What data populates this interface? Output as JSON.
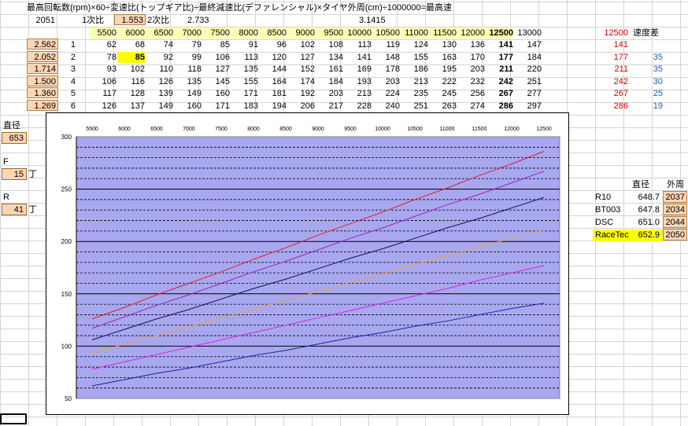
{
  "title": "最高回転数(rpm)×60÷変速比(トップギア比)÷最終減速比(デファレンシャル)×タイヤ外周(cm)÷1000000=最高速",
  "params": {
    "cell_2051": "2051",
    "first_ratio_label": "1次比",
    "first_ratio_value": "1.553",
    "second_ratio_label": "2次比",
    "second_ratio_value": "2.733",
    "pi_value": "3.1415"
  },
  "rpm_headers": [
    "5500",
    "6000",
    "6500",
    "7000",
    "7500",
    "8000",
    "8500",
    "9000",
    "9500",
    "10000",
    "10500",
    "11000",
    "11500",
    "12000",
    "12500",
    "13000"
  ],
  "extra_headers": {
    "rpm_red": "12500",
    "speed_diff": "速度差"
  },
  "gears": [
    {
      "ratio": "2.562",
      "num": "1",
      "speeds": [
        "62",
        "68",
        "74",
        "79",
        "85",
        "91",
        "96",
        "102",
        "108",
        "113",
        "119",
        "124",
        "130",
        "136",
        "141",
        "147"
      ],
      "red": "141",
      "diff": ""
    },
    {
      "ratio": "2.052",
      "num": "2",
      "speeds": [
        "78",
        "85",
        "92",
        "99",
        "106",
        "113",
        "120",
        "127",
        "134",
        "141",
        "148",
        "155",
        "163",
        "170",
        "177",
        "184"
      ],
      "red": "177",
      "diff": "35"
    },
    {
      "ratio": "1.714",
      "num": "3",
      "speeds": [
        "93",
        "102",
        "110",
        "118",
        "127",
        "135",
        "144",
        "152",
        "161",
        "169",
        "178",
        "186",
        "195",
        "203",
        "211",
        "220"
      ],
      "red": "211",
      "diff": "35"
    },
    {
      "ratio": "1.500",
      "num": "4",
      "speeds": [
        "106",
        "116",
        "126",
        "135",
        "145",
        "155",
        "164",
        "174",
        "184",
        "193",
        "203",
        "213",
        "222",
        "232",
        "242",
        "251"
      ],
      "red": "242",
      "diff": "30"
    },
    {
      "ratio": "1.360",
      "num": "5",
      "speeds": [
        "117",
        "128",
        "139",
        "149",
        "160",
        "171",
        "181",
        "192",
        "203",
        "213",
        "224",
        "235",
        "245",
        "256",
        "267",
        "277"
      ],
      "red": "267",
      "diff": "25"
    },
    {
      "ratio": "1.269",
      "num": "6",
      "speeds": [
        "126",
        "137",
        "149",
        "160",
        "171",
        "183",
        "194",
        "206",
        "217",
        "228",
        "240",
        "251",
        "263",
        "274",
        "286",
        "297"
      ],
      "red": "286",
      "diff": "19"
    }
  ],
  "side": {
    "diameter_label": "直径",
    "diameter_value": "653",
    "f_label": "F",
    "f_value": "15",
    "f_unit": "丁",
    "r_label": "R",
    "r_value": "41",
    "r_unit": "丁"
  },
  "tyre_table": {
    "header_diameter": "直径",
    "header_circumference": "外周",
    "rows": [
      {
        "name": "R10",
        "diameter": "648.7",
        "circumference": "2037",
        "highlight": false
      },
      {
        "name": "BT003",
        "diameter": "647.8",
        "circumference": "2034",
        "highlight": false
      },
      {
        "name": "DSC",
        "diameter": "651.0",
        "circumference": "2044",
        "highlight": false
      },
      {
        "name": "RaceTec",
        "diameter": "652.9",
        "circumference": "2050",
        "highlight": true
      }
    ]
  },
  "colors": {
    "plot_bg": "#a8a8f0",
    "gear_lines": [
      "#2020a0",
      "#e020e0",
      "#f0a040",
      "#101050",
      "#a020c0",
      "#e02020"
    ]
  },
  "chart_data": {
    "type": "line",
    "x": [
      5500,
      6000,
      6500,
      7000,
      7500,
      8000,
      8500,
      9000,
      9500,
      10000,
      10500,
      11000,
      11500,
      12000,
      12500
    ],
    "x_tick_labels": [
      "5500",
      "6000",
      "6500",
      "7000",
      "7500",
      "8000",
      "8500",
      "9000",
      "9500",
      "10000",
      "10500",
      "11000",
      "11500",
      "12000",
      "12500"
    ],
    "y_tick_labels": [
      "50",
      "100",
      "150",
      "200",
      "250",
      "300"
    ],
    "ylim": [
      50,
      300
    ],
    "y_major": 50,
    "y_minor": 10,
    "series": [
      {
        "values": [
          62,
          68,
          74,
          79,
          85,
          91,
          96,
          102,
          108,
          113,
          119,
          124,
          130,
          136,
          141
        ]
      },
      {
        "values": [
          78,
          85,
          92,
          99,
          106,
          113,
          120,
          127,
          134,
          141,
          148,
          155,
          163,
          170,
          177
        ]
      },
      {
        "values": [
          93,
          102,
          110,
          118,
          127,
          135,
          144,
          152,
          161,
          169,
          178,
          186,
          195,
          203,
          211
        ]
      },
      {
        "values": [
          106,
          116,
          126,
          135,
          145,
          155,
          164,
          174,
          184,
          193,
          203,
          213,
          222,
          232,
          242
        ]
      },
      {
        "values": [
          117,
          128,
          139,
          149,
          160,
          171,
          181,
          192,
          203,
          213,
          224,
          235,
          245,
          256,
          267
        ]
      },
      {
        "values": [
          126,
          137,
          149,
          160,
          171,
          183,
          194,
          206,
          217,
          228,
          240,
          251,
          263,
          274,
          286
        ]
      }
    ]
  }
}
